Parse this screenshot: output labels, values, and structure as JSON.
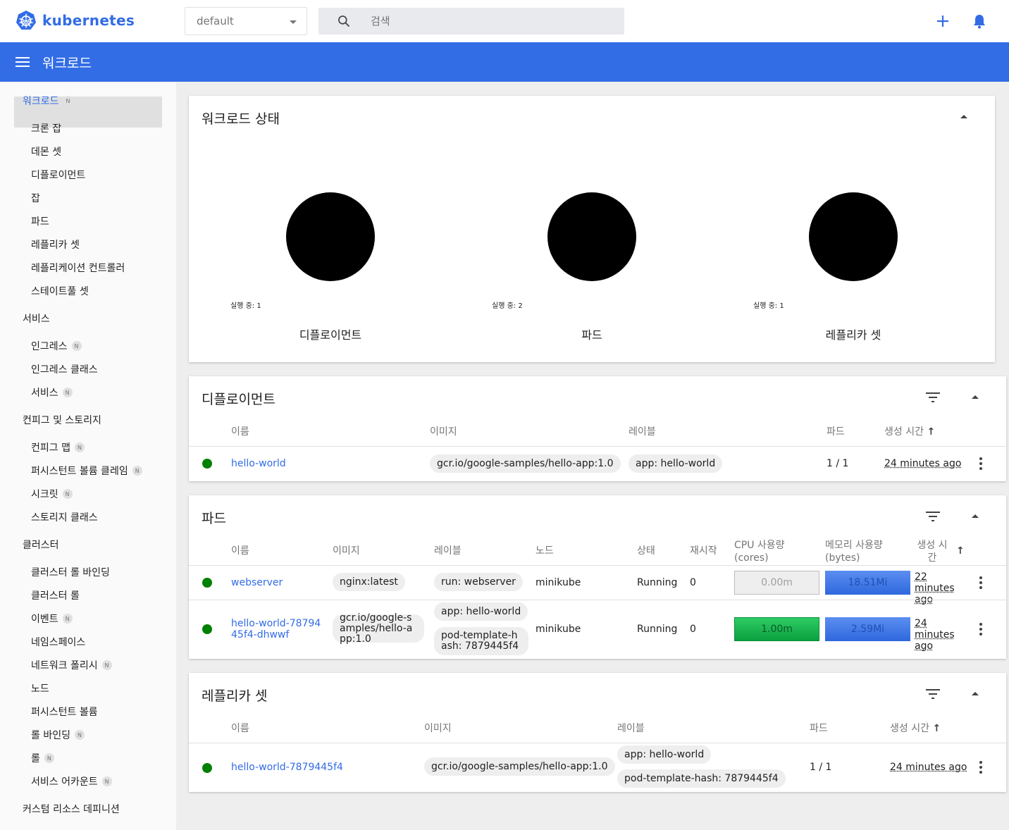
{
  "brand": {
    "name": "kubernetes",
    "color": "#326ce5"
  },
  "topbar": {
    "namespace": "default",
    "search_placeholder": "검색",
    "add_icon": "plus-icon",
    "notifications_icon": "bell-icon"
  },
  "header": {
    "title": "워크로드",
    "color": "#326de6"
  },
  "sidebar": {
    "items": [
      {
        "label": "워크로드",
        "level": "group",
        "badge": "N",
        "active": true
      },
      {
        "label": "크론 잡",
        "level": "sub"
      },
      {
        "label": "데몬 셋",
        "level": "sub"
      },
      {
        "label": "디플로이먼트",
        "level": "sub"
      },
      {
        "label": "잡",
        "level": "sub"
      },
      {
        "label": "파드",
        "level": "sub"
      },
      {
        "label": "레플리카 셋",
        "level": "sub"
      },
      {
        "label": "레플리케이션 컨트롤러",
        "level": "sub"
      },
      {
        "label": "스테이트풀 셋",
        "level": "sub"
      },
      {
        "label": "서비스",
        "level": "group"
      },
      {
        "label": "인그레스",
        "level": "sub",
        "badge": "N"
      },
      {
        "label": "인그레스 클래스",
        "level": "sub"
      },
      {
        "label": "서비스",
        "level": "sub",
        "badge": "N"
      },
      {
        "label": "컨피그 및 스토리지",
        "level": "group"
      },
      {
        "label": "컨피그 맵",
        "level": "sub",
        "badge": "N"
      },
      {
        "label": "퍼시스턴트 볼륨 클레임",
        "level": "sub",
        "badge": "N"
      },
      {
        "label": "시크릿",
        "level": "sub",
        "badge": "N"
      },
      {
        "label": "스토리지 클래스",
        "level": "sub"
      },
      {
        "label": "클러스터",
        "level": "group"
      },
      {
        "label": "클러스터 롤 바인딩",
        "level": "sub"
      },
      {
        "label": "클러스터 롤",
        "level": "sub"
      },
      {
        "label": "이벤트",
        "level": "sub",
        "badge": "N"
      },
      {
        "label": "네임스페이스",
        "level": "sub"
      },
      {
        "label": "네트워크 폴리시",
        "level": "sub",
        "badge": "N"
      },
      {
        "label": "노드",
        "level": "sub"
      },
      {
        "label": "퍼시스턴트 볼륨",
        "level": "sub"
      },
      {
        "label": "롤 바인딩",
        "level": "sub",
        "badge": "N"
      },
      {
        "label": "롤",
        "level": "sub",
        "badge": "N"
      },
      {
        "label": "서비스 어카운트",
        "level": "sub",
        "badge": "N"
      },
      {
        "label": "커스텀 리소스 데피니션",
        "level": "group"
      }
    ]
  },
  "workload_status": {
    "title": "워크로드 상태",
    "charts": [
      {
        "label": "디플로이먼트",
        "legend": "실행 중: 1"
      },
      {
        "label": "파드",
        "legend": "실행 중: 2"
      },
      {
        "label": "레플리카 셋",
        "legend": "실행 중: 1"
      }
    ]
  },
  "deployments": {
    "title": "디플로이먼트",
    "headers": [
      "이름",
      "이미지",
      "레이블",
      "파드",
      "생성 시간"
    ],
    "rows": [
      {
        "name": "hello-world",
        "image": "gcr.io/google-samples/hello-app:1.0",
        "label": "app: hello-world",
        "pods": "1 / 1",
        "created": "24 minutes ago"
      }
    ]
  },
  "pods": {
    "title": "파드",
    "headers": {
      "name": "이름",
      "image": "이미지",
      "labels": "레이블",
      "node": "노드",
      "status": "상태",
      "restarts": "재시작",
      "cpu": "CPU 사용량 (cores)",
      "memory": "메모리 사용량 (bytes)",
      "created": "생성 시간"
    },
    "rows": [
      {
        "name": "webserver",
        "image": "nginx:latest",
        "label1": "run: webserver",
        "label2": "",
        "node": "minikube",
        "status": "Running",
        "restarts": "0",
        "cpu": "0.00m",
        "memory": "18.51Mi",
        "created": "22 minutes ago"
      },
      {
        "name": "hello-world-7879445f4-dhwwf",
        "image": "gcr.io/google-samples/hello-app:1.0",
        "label1": "app: hello-world",
        "label2": "pod-template-hash: 7879445f4",
        "node": "minikube",
        "status": "Running",
        "restarts": "0",
        "cpu": "1.00m",
        "memory": "2.59Mi",
        "created": "24 minutes ago"
      }
    ],
    "colors": {
      "cpu_idle": "#e0e0e0",
      "cpu_active": "#00c752",
      "memory": "#326ce5"
    }
  },
  "replicasets": {
    "title": "레플리카 셋",
    "headers": [
      "이름",
      "이미지",
      "레이블",
      "파드",
      "생성 시간"
    ],
    "rows": [
      {
        "name": "hello-world-7879445f4",
        "image": "gcr.io/google-samples/hello-app:1.0",
        "label1": "app: hello-world",
        "label2": "pod-template-hash: 7879445f4",
        "pods": "1 / 1",
        "created": "24 minutes ago"
      }
    ]
  }
}
